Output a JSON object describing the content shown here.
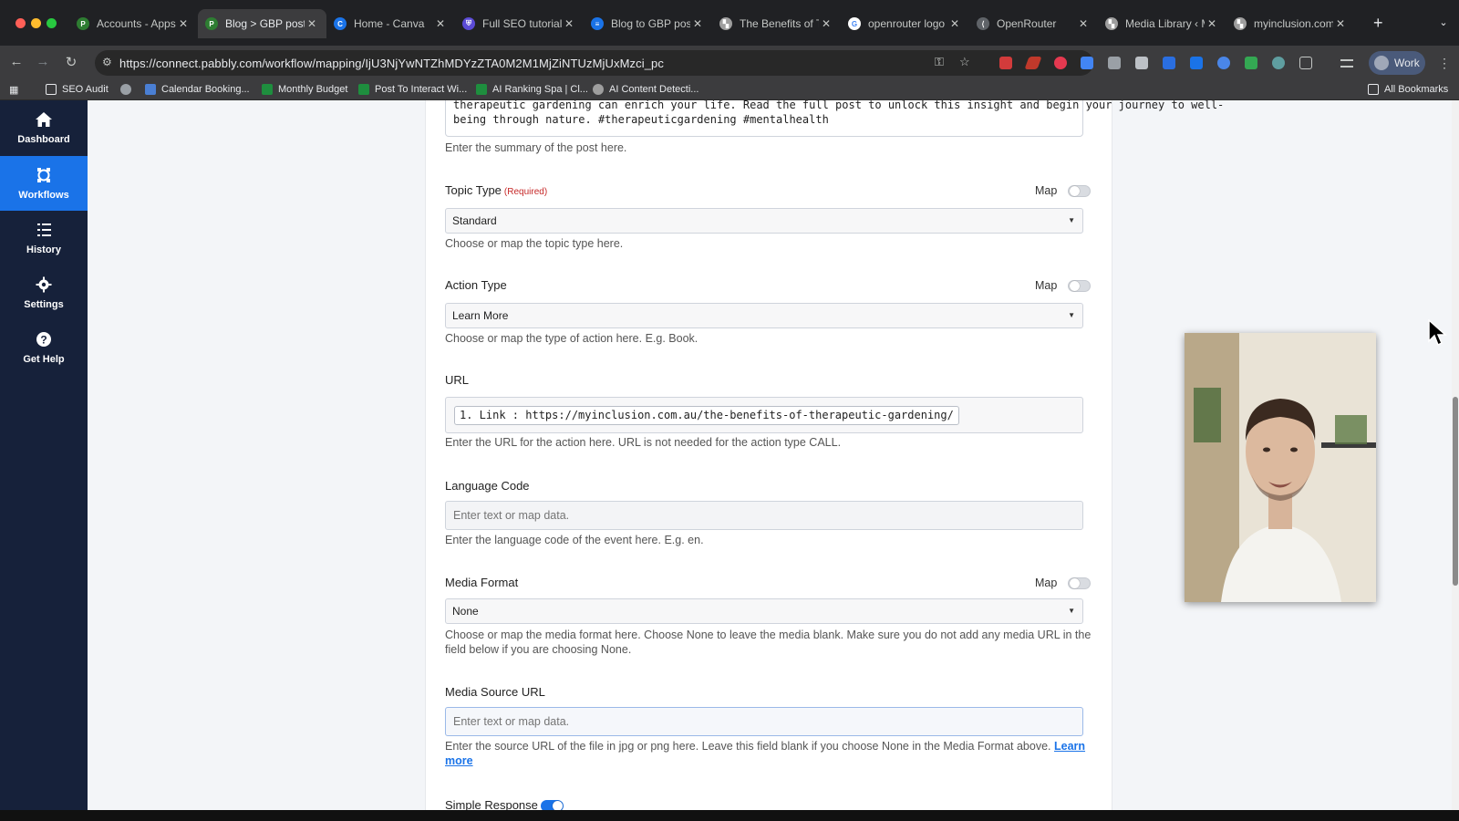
{
  "browser": {
    "tabs": [
      {
        "label": "Accounts - Apps",
        "fav_color": "#2e7d32",
        "fav_glyph": "P"
      },
      {
        "label": "Blog > GBP post",
        "fav_color": "#2e7d32",
        "fav_glyph": "P"
      },
      {
        "label": "Home - Canva",
        "fav_color": "#1a73e8",
        "fav_glyph": "C"
      },
      {
        "label": "Full SEO tutorial",
        "fav_color": "#5b4bd6",
        "fav_glyph": "⛨"
      },
      {
        "label": "Blog to GBP post",
        "fav_color": "#1a73e8",
        "fav_glyph": "≡"
      },
      {
        "label": "The Benefits of T",
        "fav_color": "#9e9e9e",
        "fav_glyph": "▚"
      },
      {
        "label": "openrouter logo",
        "fav_color": "#ffffff",
        "fav_glyph": "G"
      },
      {
        "label": "OpenRouter",
        "fav_color": "#5f6368",
        "fav_glyph": "⟨"
      },
      {
        "label": "Media Library ‹ M",
        "fav_color": "#9e9e9e",
        "fav_glyph": "▚"
      },
      {
        "label": "myinclusion.com",
        "fav_color": "#9e9e9e",
        "fav_glyph": "▚"
      }
    ],
    "close_glyph": "✕",
    "new_tab": "+",
    "tab_menu": "⌄",
    "url": "https://connect.pabbly.com/workflow/mapping/IjU3NjYwNTZhMDYzZTA0M2M1MjZiNTUzMjUxMzci_pc",
    "profile": "Work",
    "bookmarks": [
      {
        "label": "SEO Audit",
        "color": "#e8eaed"
      },
      {
        "label": "",
        "color": "#e8eaed"
      },
      {
        "label": "Calendar Booking...",
        "color": "#4a7fd4"
      },
      {
        "label": "Monthly Budget",
        "color": "#1e8e3e"
      },
      {
        "label": "Post To Interact Wi...",
        "color": "#1e8e3e"
      },
      {
        "label": "AI Ranking Spa | Cl...",
        "color": "#1e8e3e"
      },
      {
        "label": "AI Content Detecti...",
        "color": "#9e9e9e"
      }
    ],
    "all_bookmarks": "All Bookmarks"
  },
  "sidebar": {
    "items": [
      {
        "label": "Dashboard",
        "icon": "home-icon"
      },
      {
        "label": "Workflows",
        "icon": "workflow-icon",
        "active": true
      },
      {
        "label": "History",
        "icon": "list-icon"
      },
      {
        "label": "Settings",
        "icon": "gear-icon"
      },
      {
        "label": "Get Help",
        "icon": "help-icon"
      }
    ]
  },
  "form": {
    "summary": {
      "lines": [
        "therapeutic gardening can enrich your life. Read the full post to unlock this insight and begin your journey to well-",
        "being through nature. #therapeuticgardening #mentalhealth"
      ],
      "help": "Enter the summary of the post here."
    },
    "map_label": "Map",
    "topic_type": {
      "label": "Topic Type",
      "required": "(Required)",
      "value": "Standard",
      "map_on": false,
      "help": "Choose or map the topic type here."
    },
    "action_type": {
      "label": "Action Type",
      "value": "Learn More",
      "map_on": false,
      "help": "Choose or map the type of action here. E.g. Book."
    },
    "url": {
      "label": "URL",
      "chip": "1. Link : https://myinclusion.com.au/the-benefits-of-therapeutic-gardening/",
      "help": "Enter the URL for the action here. URL is not needed for the action type CALL."
    },
    "language_code": {
      "label": "Language Code",
      "placeholder": "Enter text or map data.",
      "help": "Enter the language code of the event here. E.g. en."
    },
    "media_format": {
      "label": "Media Format",
      "value": "None",
      "map_on": false,
      "help": "Choose or map the media format here. Choose None to leave the media blank. Make sure you do not add any media URL in the field below if you are choosing None."
    },
    "media_source_url": {
      "label": "Media Source URL",
      "placeholder": "Enter text or map data.",
      "help": "Enter the source URL of the file in jpg or png here. Leave this field blank if you choose None in the Media Format above.",
      "learn_more": "Learn more"
    },
    "simple_response": {
      "label": "Simple Response",
      "on": true
    }
  },
  "colors": {
    "accent": "#1a73e8",
    "sidebar_bg": "#16213a",
    "required": "#c62828"
  }
}
